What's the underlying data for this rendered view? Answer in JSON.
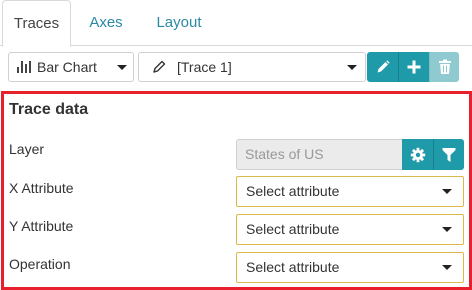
{
  "tabs": [
    {
      "label": "Traces",
      "active": true
    },
    {
      "label": "Axes",
      "active": false
    },
    {
      "label": "Layout",
      "active": false
    }
  ],
  "toolbar": {
    "chart_type": {
      "label": "Bar Chart",
      "icon": "bar-chart-icon"
    },
    "trace": {
      "label": "[Trace 1]",
      "icon": "pencil-icon"
    },
    "buttons": [
      {
        "icon": "pencil-icon",
        "action": "edit"
      },
      {
        "icon": "plus-icon",
        "action": "add"
      },
      {
        "icon": "trash-icon",
        "action": "delete"
      }
    ]
  },
  "panel": {
    "title": "Trace data",
    "layer": {
      "label": "Layer",
      "value": "States of US",
      "buttons": [
        "gear-icon",
        "filter-icon"
      ]
    },
    "x_attribute": {
      "label": "X Attribute",
      "value": "Select attribute"
    },
    "y_attribute": {
      "label": "Y Attribute",
      "value": "Select attribute"
    },
    "operation": {
      "label": "Operation",
      "value": "Select attribute"
    }
  },
  "colors": {
    "accent": "#1f9aa8",
    "accent_disabled": "#8fcad1",
    "tab_link": "#2a8aa3",
    "highlight_border": "#e8202b",
    "select_border": "#d9b94a",
    "input_disabled_bg": "#ebebeb"
  }
}
